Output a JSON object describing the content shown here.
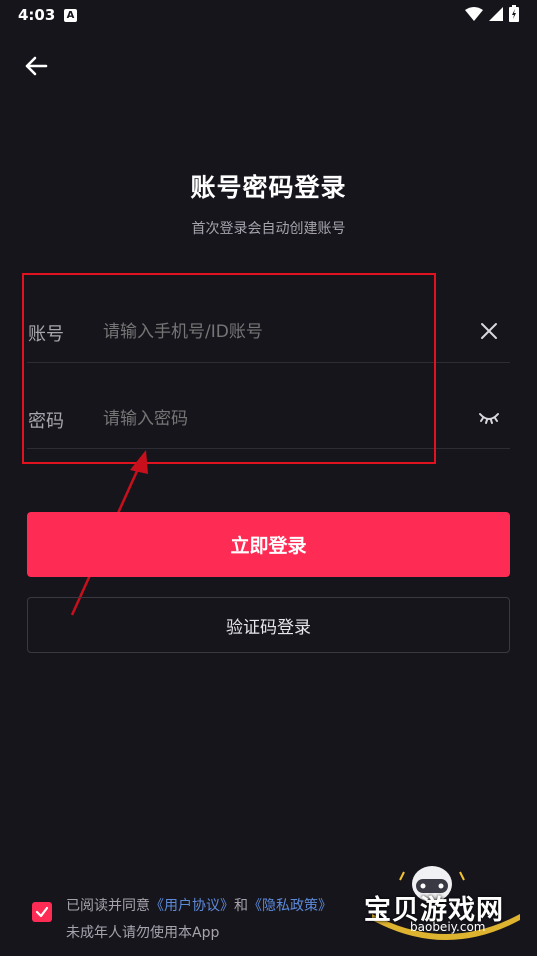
{
  "status_bar": {
    "time": "4:03",
    "notification_letter": "A"
  },
  "header": {
    "title": "账号密码登录",
    "subtitle": "首次登录会自动创建账号"
  },
  "account_row": {
    "label": "账号",
    "placeholder": "请输入手机号/ID账号"
  },
  "password_row": {
    "label": "密码",
    "placeholder": "请输入密码"
  },
  "buttons": {
    "login": "立即登录",
    "sms_login": "验证码登录"
  },
  "agreement": {
    "prefix": "已阅读并同意",
    "user_agreement": "《用户协议》",
    "and": "和",
    "privacy_policy": "《隐私政策》",
    "minor_notice": "未成年人请勿使用本App",
    "checked": true
  },
  "watermark": {
    "name": "宝贝游戏网",
    "url": "baobeiy.com"
  },
  "colors": {
    "background": "#17151c",
    "primary": "#fe2c55",
    "link": "#5c8ad9",
    "annotation": "#e0121f"
  }
}
